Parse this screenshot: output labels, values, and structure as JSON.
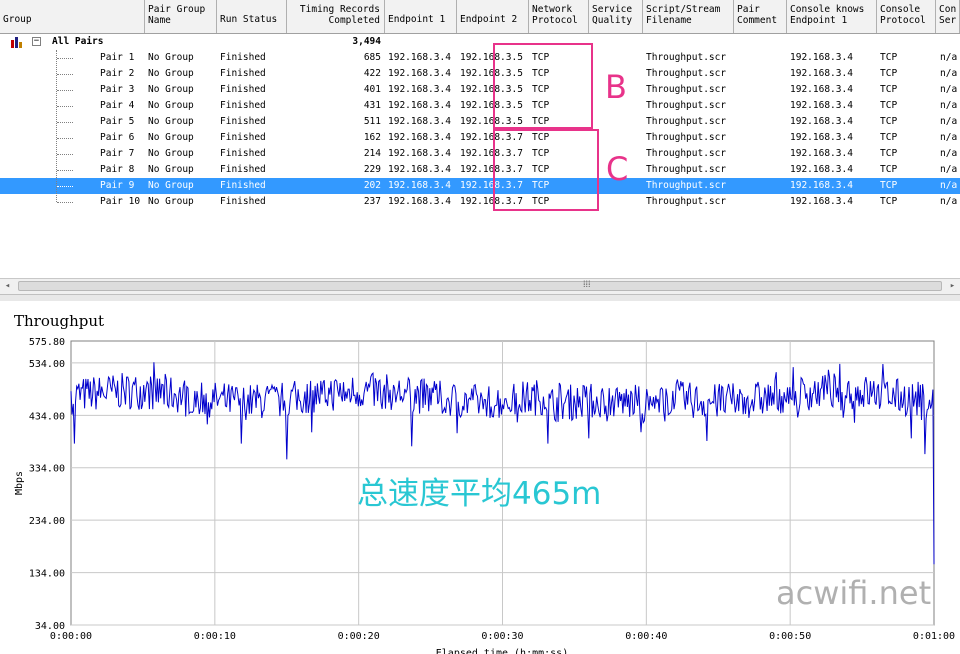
{
  "table": {
    "columns": [
      {
        "label": "Group",
        "x": 0,
        "w": 145,
        "align": "left",
        "bottom": true
      },
      {
        "label": "Pair Group\nName",
        "x": 145,
        "w": 72,
        "align": "left"
      },
      {
        "label": "Run Status",
        "x": 217,
        "w": 70,
        "align": "left",
        "bottom": true
      },
      {
        "label": "Timing Records\nCompleted",
        "x": 287,
        "w": 98,
        "align": "right"
      },
      {
        "label": "Endpoint 1",
        "x": 385,
        "w": 72,
        "align": "left",
        "bottom": true
      },
      {
        "label": "Endpoint 2",
        "x": 457,
        "w": 72,
        "align": "left",
        "bottom": true
      },
      {
        "label": "Network\nProtocol",
        "x": 529,
        "w": 60,
        "align": "left"
      },
      {
        "label": "Service\nQuality",
        "x": 589,
        "w": 54,
        "align": "left"
      },
      {
        "label": "Script/Stream\nFilename",
        "x": 643,
        "w": 91,
        "align": "left"
      },
      {
        "label": "Pair\nComment",
        "x": 734,
        "w": 53,
        "align": "left"
      },
      {
        "label": "Console knows\nEndpoint 1",
        "x": 787,
        "w": 90,
        "align": "left"
      },
      {
        "label": "Console\nProtocol",
        "x": 877,
        "w": 59,
        "align": "left"
      },
      {
        "label": "Con\nSer",
        "x": 936,
        "w": 24,
        "align": "left"
      }
    ],
    "group_row": {
      "label": "All Pairs",
      "records": "3,494"
    },
    "rows": [
      {
        "pair": "Pair 1",
        "group": "No Group",
        "status": "Finished",
        "records": "685",
        "ep1": "192.168.3.4",
        "ep2": "192.168.3.5",
        "proto": "TCP",
        "script": "Throughput.scr",
        "console_ep1": "192.168.3.4",
        "console_proto": "TCP",
        "con_ser": "n/a"
      },
      {
        "pair": "Pair 2",
        "group": "No Group",
        "status": "Finished",
        "records": "422",
        "ep1": "192.168.3.4",
        "ep2": "192.168.3.5",
        "proto": "TCP",
        "script": "Throughput.scr",
        "console_ep1": "192.168.3.4",
        "console_proto": "TCP",
        "con_ser": "n/a"
      },
      {
        "pair": "Pair 3",
        "group": "No Group",
        "status": "Finished",
        "records": "401",
        "ep1": "192.168.3.4",
        "ep2": "192.168.3.5",
        "proto": "TCP",
        "script": "Throughput.scr",
        "console_ep1": "192.168.3.4",
        "console_proto": "TCP",
        "con_ser": "n/a"
      },
      {
        "pair": "Pair 4",
        "group": "No Group",
        "status": "Finished",
        "records": "431",
        "ep1": "192.168.3.4",
        "ep2": "192.168.3.5",
        "proto": "TCP",
        "script": "Throughput.scr",
        "console_ep1": "192.168.3.4",
        "console_proto": "TCP",
        "con_ser": "n/a"
      },
      {
        "pair": "Pair 5",
        "group": "No Group",
        "status": "Finished",
        "records": "511",
        "ep1": "192.168.3.4",
        "ep2": "192.168.3.5",
        "proto": "TCP",
        "script": "Throughput.scr",
        "console_ep1": "192.168.3.4",
        "console_proto": "TCP",
        "con_ser": "n/a"
      },
      {
        "pair": "Pair 6",
        "group": "No Group",
        "status": "Finished",
        "records": "162",
        "ep1": "192.168.3.4",
        "ep2": "192.168.3.7",
        "proto": "TCP",
        "script": "Throughput.scr",
        "console_ep1": "192.168.3.4",
        "console_proto": "TCP",
        "con_ser": "n/a"
      },
      {
        "pair": "Pair 7",
        "group": "No Group",
        "status": "Finished",
        "records": "214",
        "ep1": "192.168.3.4",
        "ep2": "192.168.3.7",
        "proto": "TCP",
        "script": "Throughput.scr",
        "console_ep1": "192.168.3.4",
        "console_proto": "TCP",
        "con_ser": "n/a"
      },
      {
        "pair": "Pair 8",
        "group": "No Group",
        "status": "Finished",
        "records": "229",
        "ep1": "192.168.3.4",
        "ep2": "192.168.3.7",
        "proto": "TCP",
        "script": "Throughput.scr",
        "console_ep1": "192.168.3.4",
        "console_proto": "TCP",
        "con_ser": "n/a"
      },
      {
        "pair": "Pair 9",
        "group": "No Group",
        "status": "Finished",
        "records": "202",
        "ep1": "192.168.3.4",
        "ep2": "192.168.3.7",
        "proto": "TCP",
        "script": "Throughput.scr",
        "console_ep1": "192.168.3.4",
        "console_proto": "TCP",
        "con_ser": "n/a",
        "selected": true
      },
      {
        "pair": "Pair 10",
        "group": "No Group",
        "status": "Finished",
        "records": "237",
        "ep1": "192.168.3.4",
        "ep2": "192.168.3.7",
        "proto": "TCP",
        "script": "Throughput.scr",
        "console_ep1": "192.168.3.4",
        "console_proto": "TCP",
        "con_ser": "n/a"
      }
    ]
  },
  "scrollbar": {
    "left_arrow": "◂",
    "right_arrow": "▸",
    "grip": "⁞⁞⁞"
  },
  "annotations": {
    "label_b": "B",
    "label_c": "C",
    "box_color": "#e8338a",
    "overlay_text": "总速度平均465m",
    "overlay_color": "#29c7d3",
    "watermark": "acwifi.net"
  },
  "chart_data": {
    "type": "line",
    "title": "Throughput",
    "ylabel": "Mbps",
    "xlabel": "Elapsed time (h:mm:ss)",
    "ylim": [
      34.0,
      575.8
    ],
    "yticks": [
      "534.00",
      "434.00",
      "334.00",
      "234.00",
      "134.00",
      "34.00"
    ],
    "ytick_values": [
      534,
      434,
      334,
      234,
      134,
      34
    ],
    "ytop_label": "575.80",
    "xticks": [
      "0:00:00",
      "0:00:10",
      "0:00:20",
      "0:00:30",
      "0:00:40",
      "0:00:50",
      "0:01:00"
    ],
    "xlim_seconds": [
      0,
      60
    ],
    "series": [
      {
        "color": "#0000cc",
        "average": 465
      }
    ],
    "grid": true
  }
}
